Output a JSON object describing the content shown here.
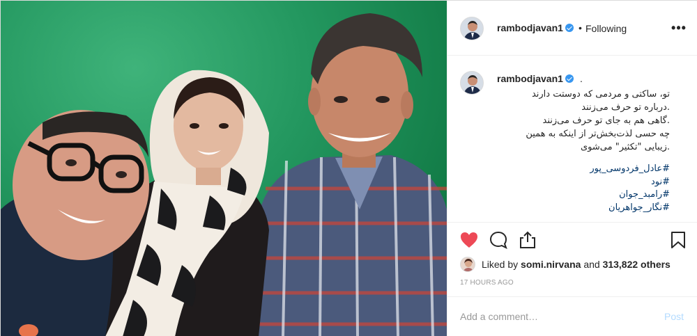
{
  "header": {
    "username": "rambodjavan1",
    "separator": "•",
    "follow_status": "Following",
    "more_icon": "more-options-icon",
    "more_glyph": "•••"
  },
  "caption": {
    "username": "rambodjavan1",
    "trailing": ".",
    "lines": [
      "تو، ساکتی و مردمی که دوستت دارند",
      ".درباره تو حرف می‌زنند",
      ".گاهی هم به جای تو حرف می‌زنند",
      "چه حسی لذت‌بخش‌تر از اینکه به همین",
      ".زیبایی \"تکثیر\" می‌شوی"
    ],
    "hashtags": [
      "#عادل_فردوسی_پور",
      "#نود",
      "#رامبد_جوان",
      "#نگار_جواهریان"
    ]
  },
  "actions": {
    "like_icon": "heart-filled-icon",
    "comment_icon": "comment-bubble-icon",
    "share_icon": "share-icon",
    "save_icon": "bookmark-icon",
    "like_color": "#ed4956"
  },
  "likes": {
    "prefix": "Liked by",
    "user": "somi.nirvana",
    "middle": "and",
    "count": "313,822 others"
  },
  "timestamp": "17 HOURS AGO",
  "comment_box": {
    "placeholder": "Add a comment…",
    "post_label": "Post"
  },
  "colors": {
    "verified_badge": "#3897f0",
    "hashtag": "#003569",
    "post_disabled": "#b3dbff",
    "muted": "#999999"
  }
}
